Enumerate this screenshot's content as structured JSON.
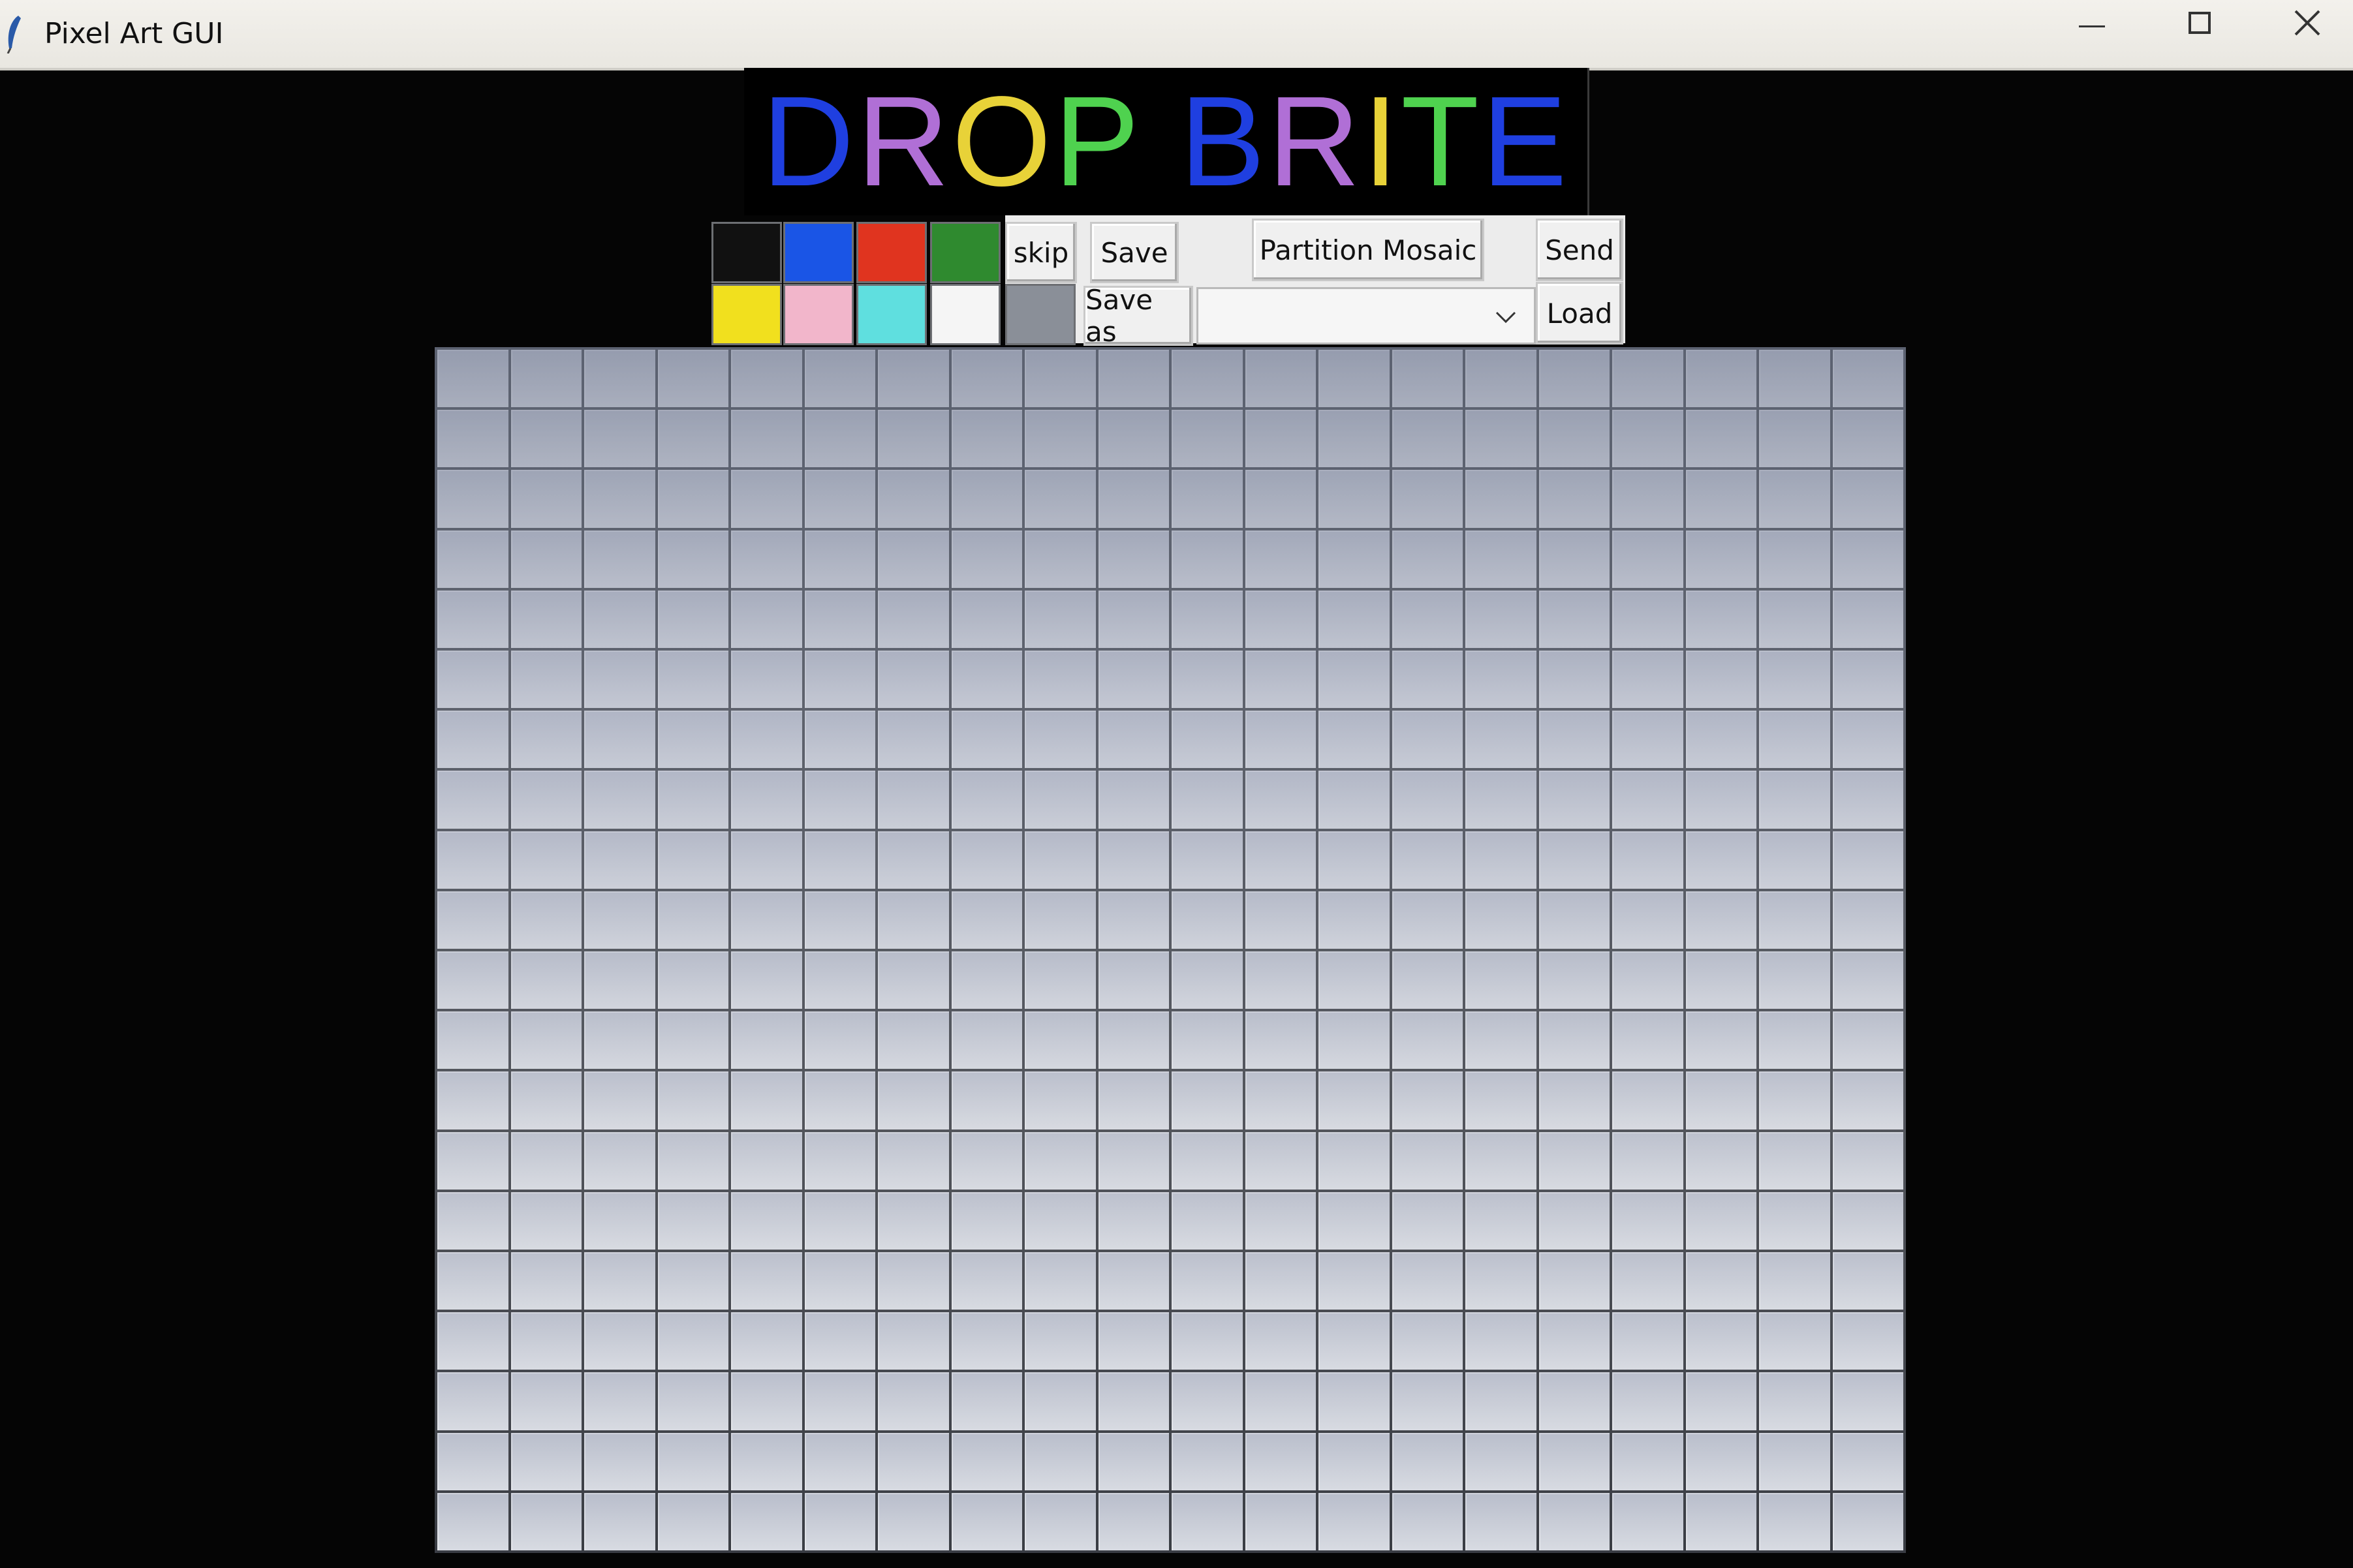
{
  "window": {
    "title": "Pixel Art GUI",
    "controls": [
      "minimize-icon",
      "maximize-icon",
      "close-icon"
    ]
  },
  "logo": {
    "letters": [
      {
        "char": "D",
        "color": "#1f3fe0"
      },
      {
        "char": "R",
        "color": "#b06fd6"
      },
      {
        "char": "O",
        "color": "#e8d238"
      },
      {
        "char": "P",
        "color": "#4fd24f"
      },
      {
        "char": " ",
        "color": "#000000"
      },
      {
        "char": "B",
        "color": "#1f3fe0"
      },
      {
        "char": "R",
        "color": "#b06fd6"
      },
      {
        "char": "I",
        "color": "#e8d238"
      },
      {
        "char": "T",
        "color": "#4fd24f"
      },
      {
        "char": "E",
        "color": "#1f3fe0"
      }
    ]
  },
  "palette": {
    "row1": [
      "#111111",
      "#1a55e6",
      "#e0341f",
      "#2f8a2f"
    ],
    "row2": [
      "#f1e01e",
      "#f2b6cb",
      "#5fdfdf",
      "#f5f5f5"
    ],
    "selected_color": "#8a8f98"
  },
  "toolbar": {
    "skip_label": "skip",
    "save_label": "Save",
    "partition_label": "Partition Mosaic",
    "send_label": "Send",
    "save_as_label": "Save as",
    "load_label": "Load",
    "file_select_value": ""
  },
  "grid": {
    "rows": 20,
    "columns": 20,
    "cell_color": "#d3d6de",
    "line_color": "#3a3d44"
  }
}
